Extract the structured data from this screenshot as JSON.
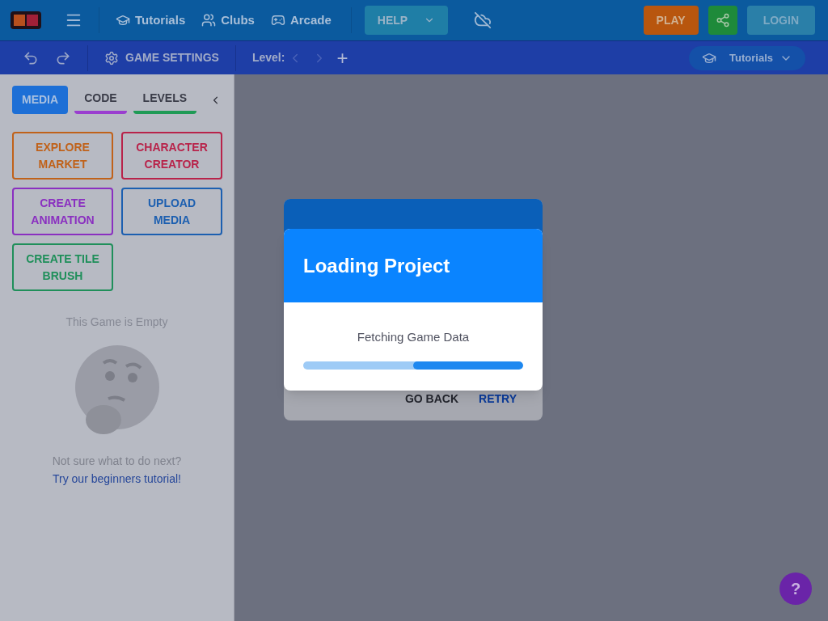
{
  "top_bar": {
    "nav": [
      {
        "label": "Tutorials",
        "kind": "tutorials"
      },
      {
        "label": "Clubs",
        "kind": "clubs"
      },
      {
        "label": "Arcade",
        "kind": "arcade"
      }
    ],
    "help": "HELP",
    "play": "PLAY",
    "login": "LOGIN"
  },
  "toolbar": {
    "game_settings": "GAME SETTINGS",
    "level_label": "Level:",
    "add": "+",
    "tutorials": "Tutorials"
  },
  "sidebar": {
    "tabs": [
      {
        "label": "MEDIA",
        "selected": true,
        "color": "#1d6fd6"
      },
      {
        "label": "CODE",
        "selected": false,
        "color": "#9a3ecf"
      },
      {
        "label": "LEVELS",
        "selected": false,
        "color": "#1f9a55"
      }
    ],
    "actions": [
      {
        "label": "EXPLORE MARKET",
        "color": "#c0621a"
      },
      {
        "label": "CHARACTER CREATOR",
        "color": "#b8234a"
      },
      {
        "label": "CREATE ANIMATION",
        "color": "#8a2fc0"
      },
      {
        "label": "UPLOAD MEDIA",
        "color": "#1c5fb0"
      },
      {
        "label": "CREATE TILE BRUSH",
        "color": "#1f8f5a"
      }
    ],
    "empty_title": "This Game is Empty",
    "hint": "Not sure what to do next?",
    "hint_link": "Try our beginners tutorial!"
  },
  "back_dialog": {
    "buttons": [
      "GO BACK",
      "RETRY"
    ]
  },
  "dialog": {
    "title": "Loading Project",
    "message": "Fetching Game Data",
    "level": 0.5
  },
  "help_fab": "?"
}
